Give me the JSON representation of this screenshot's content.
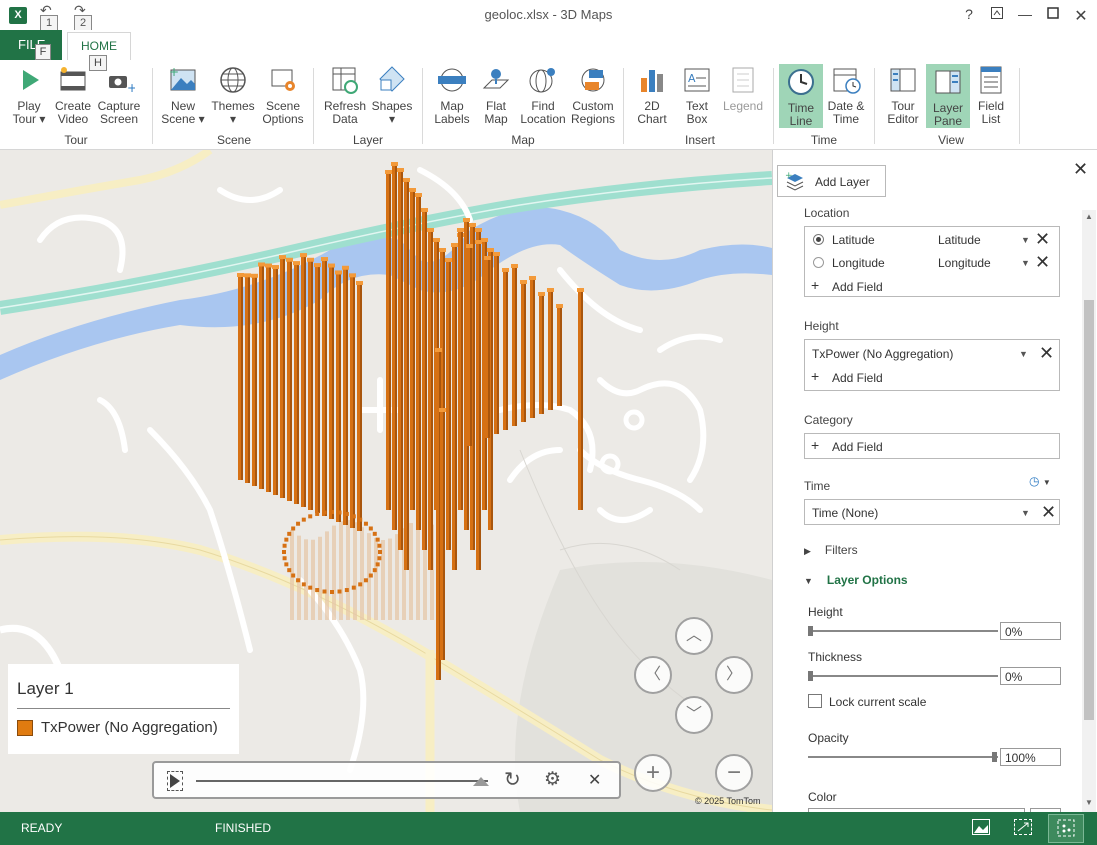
{
  "titlebar": {
    "title": "geoloc.xlsx - 3D Maps",
    "undo_key": "1",
    "redo_key": "2",
    "help": "?",
    "file_key": "F",
    "home_key": "H"
  },
  "tabs": {
    "file": "FILE",
    "home": "HOME"
  },
  "ribbon": {
    "tour": {
      "label": "Tour",
      "play": [
        "Play",
        "Tour"
      ],
      "create_video": [
        "Create",
        "Video"
      ],
      "capture": [
        "Capture",
        "Screen"
      ]
    },
    "scene": {
      "label": "Scene",
      "new_scene": [
        "New",
        "Scene"
      ],
      "themes": [
        "Themes",
        ""
      ],
      "scene_options": [
        "Scene",
        "Options"
      ]
    },
    "layer": {
      "label": "Layer",
      "refresh": [
        "Refresh",
        "Data"
      ],
      "shapes": [
        "Shapes",
        ""
      ]
    },
    "map": {
      "label": "Map",
      "map_labels": [
        "Map",
        "Labels"
      ],
      "flat_map": [
        "Flat",
        "Map"
      ],
      "find_location": [
        "Find",
        "Location"
      ],
      "custom_regions": [
        "Custom",
        "Regions"
      ]
    },
    "insert": {
      "label": "Insert",
      "chart": [
        "2D",
        "Chart"
      ],
      "text_box": [
        "Text",
        "Box"
      ],
      "legend": [
        "Legend",
        ""
      ]
    },
    "time": {
      "label": "Time",
      "time_line": [
        "Time",
        "Line"
      ],
      "date_time": [
        "Date &",
        "Time"
      ]
    },
    "view": {
      "label": "View",
      "tour_editor": [
        "Tour",
        "Editor"
      ],
      "layer_pane": [
        "Layer",
        "Pane"
      ],
      "field_list": [
        "Field",
        "List"
      ]
    }
  },
  "legend": {
    "title": "Layer 1",
    "item": "TxPower (No Aggregation)",
    "item_color": "#e07b10"
  },
  "attribution": "© 2025 TomTom",
  "pane": {
    "add_layer": "Add Layer",
    "location_label": "Location",
    "location_rows": [
      {
        "name": "Latitude",
        "type": "Latitude",
        "selected": true
      },
      {
        "name": "Longitude",
        "type": "Longitude",
        "selected": false
      }
    ],
    "add_field": "Add Field",
    "height_label": "Height",
    "height_value": "TxPower (No Aggregation)",
    "category_label": "Category",
    "time_label": "Time",
    "time_value": "Time (None)",
    "filters": "Filters",
    "layer_options": "Layer Options",
    "opt_height_label": "Height",
    "opt_height_value": "0%",
    "opt_thickness_label": "Thickness",
    "opt_thickness_value": "0%",
    "lock_scale": "Lock current scale",
    "opacity_label": "Opacity",
    "opacity_value": "100%",
    "color_label": "Color"
  },
  "status": {
    "ready": "READY",
    "finished": "FINISHED"
  },
  "colors": {
    "excel_green": "#217346",
    "active_button": "#9fd5b7",
    "bar_orange": "#d67114",
    "water": "#a9c6f0",
    "highway": "#9fdfcf"
  }
}
